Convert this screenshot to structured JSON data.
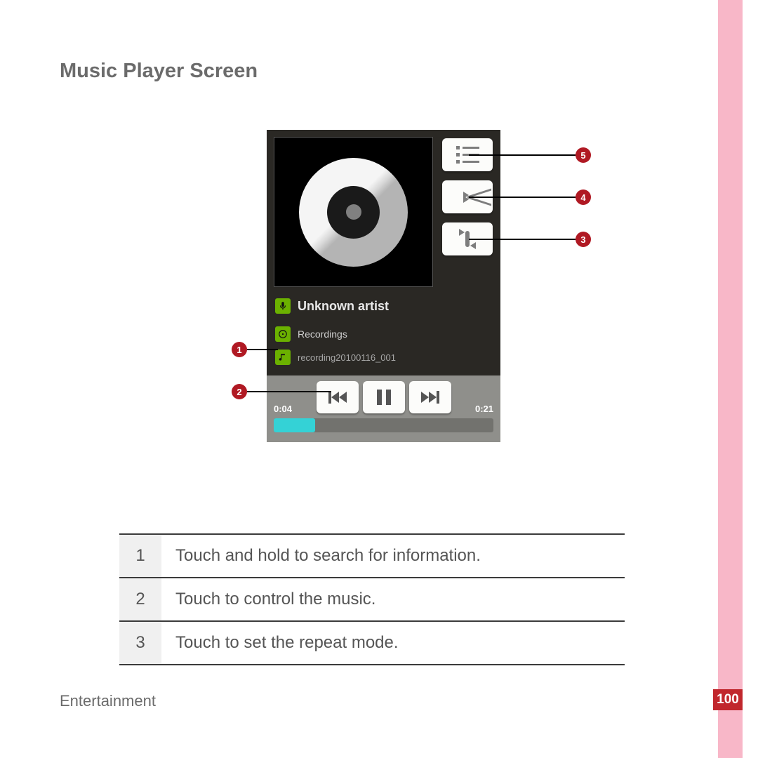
{
  "heading": "Music Player Screen",
  "section_label": "Entertainment",
  "page_number": "100",
  "player": {
    "artist_label": "Unknown artist",
    "album_label": "Recordings",
    "track_label": "recording20100116_001",
    "time_elapsed": "0:04",
    "time_total": "0:21"
  },
  "callouts": {
    "c1": "1",
    "c2": "2",
    "c3": "3",
    "c4": "4",
    "c5": "5"
  },
  "table": {
    "rows": [
      {
        "n": "1",
        "t": "Touch and hold to search for information."
      },
      {
        "n": "2",
        "t": "Touch to control the music."
      },
      {
        "n": "3",
        "t": "Touch to set the repeat mode."
      }
    ]
  }
}
